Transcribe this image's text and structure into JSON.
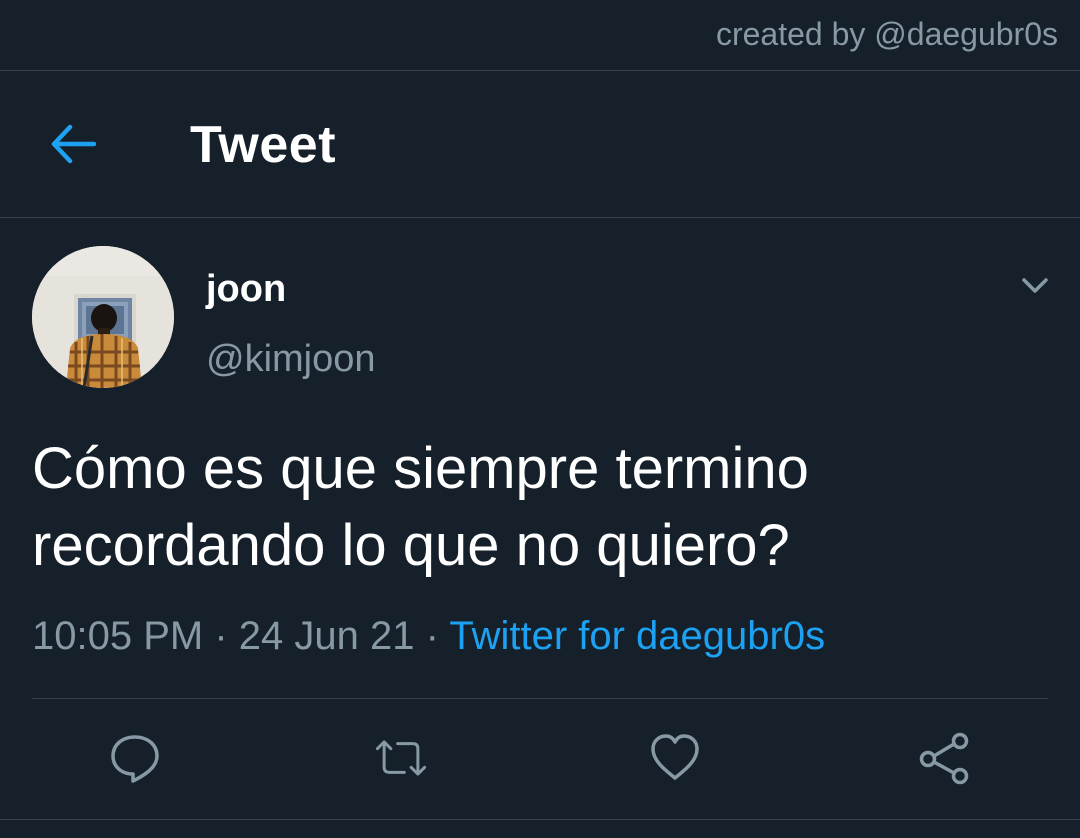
{
  "watermark": {
    "text": "created by @daegubr0s"
  },
  "header": {
    "title": "Tweet",
    "back_icon": "arrow-left-icon"
  },
  "tweet": {
    "author": {
      "name": "joon",
      "handle": "@kimjoon"
    },
    "text": "Cómo es que siempre termino recordando lo que no quiero?",
    "time": "10:05 PM",
    "separator": "·",
    "date": "24 Jun 21",
    "source": "Twitter for daegubr0s"
  },
  "actions": [
    {
      "name": "reply",
      "icon": "reply-icon"
    },
    {
      "name": "retweet",
      "icon": "retweet-icon"
    },
    {
      "name": "like",
      "icon": "heart-icon"
    },
    {
      "name": "share",
      "icon": "share-icon"
    }
  ],
  "colors": {
    "background": "#15202b",
    "border": "#38444d",
    "accent": "#1da1f2",
    "secondary_text": "#8899a6",
    "primary_text": "#ffffff"
  }
}
